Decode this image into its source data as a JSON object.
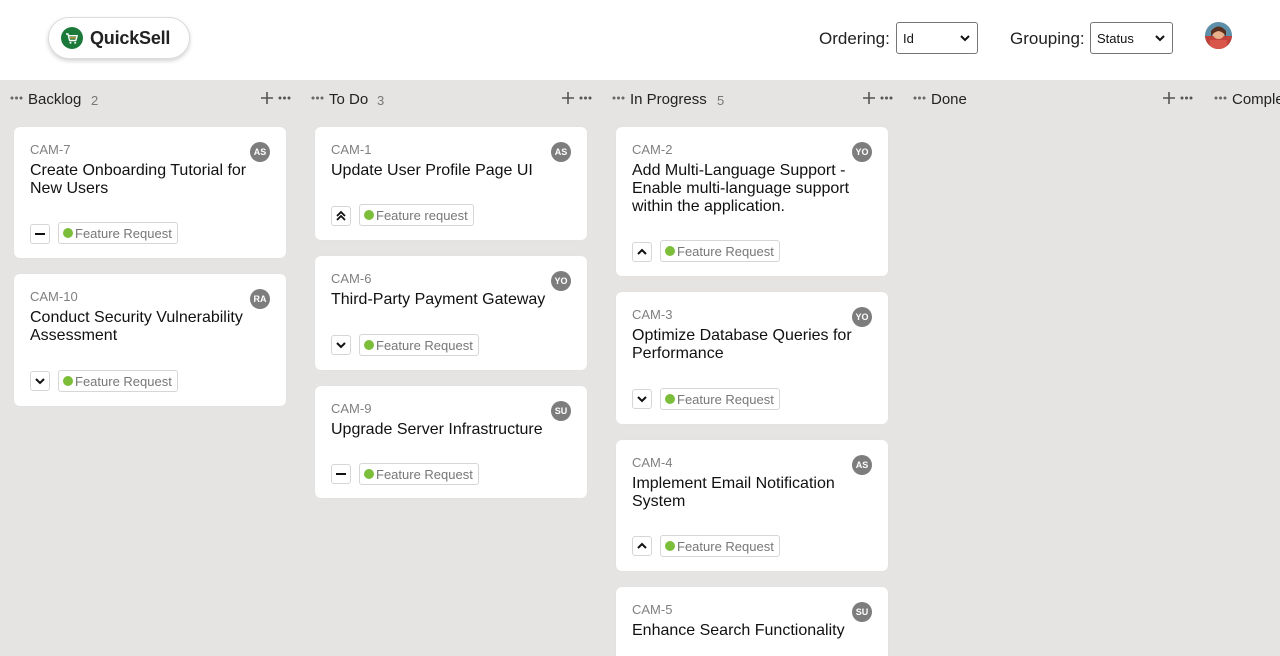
{
  "header": {
    "logo_text": "QuickSell",
    "ordering_label": "Ordering:",
    "ordering_value": "Id",
    "grouping_label": "Grouping:",
    "grouping_value": "Status"
  },
  "columns": [
    {
      "title": "Backlog",
      "count": "2"
    },
    {
      "title": "To Do",
      "count": "3"
    },
    {
      "title": "In Progress",
      "count": "5"
    },
    {
      "title": "Done",
      "count": ""
    },
    {
      "title": "Comple",
      "count": ""
    }
  ],
  "cards": {
    "backlog": [
      {
        "id": "CAM-7",
        "avatar": "AS",
        "title": "Create Onboarding Tutorial for New Users",
        "priority_icon": "no-priority-icon",
        "tag": "Feature Request"
      },
      {
        "id": "CAM-10",
        "avatar": "RA",
        "title": "Conduct Security Vulnerability Assessment",
        "priority_icon": "low-priority-icon",
        "tag": "Feature Request"
      }
    ],
    "todo": [
      {
        "id": "CAM-1",
        "avatar": "AS",
        "title": "Update User Profile Page UI",
        "priority_icon": "urgent-priority-icon",
        "tag": "Feature request"
      },
      {
        "id": "CAM-6",
        "avatar": "YO",
        "title": "Third-Party Payment Gateway",
        "priority_icon": "low-priority-icon",
        "tag": "Feature Request"
      },
      {
        "id": "CAM-9",
        "avatar": "SU",
        "title": "Upgrade Server Infrastructure",
        "priority_icon": "no-priority-icon",
        "tag": "Feature Request"
      }
    ],
    "in_progress": [
      {
        "id": "CAM-2",
        "avatar": "YO",
        "title": "Add Multi-Language Support - Enable multi-language support within the application.",
        "priority_icon": "high-priority-icon",
        "tag": "Feature Request"
      },
      {
        "id": "CAM-3",
        "avatar": "YO",
        "title": "Optimize Database Queries for Performance",
        "priority_icon": "low-priority-icon",
        "tag": "Feature Request"
      },
      {
        "id": "CAM-4",
        "avatar": "AS",
        "title": "Implement Email Notification System",
        "priority_icon": "high-priority-icon",
        "tag": "Feature Request"
      },
      {
        "id": "CAM-5",
        "avatar": "SU",
        "title": "Enhance Search Functionality",
        "priority_icon": "",
        "tag": ""
      }
    ]
  },
  "colors": {
    "board_bg": "#e5e4e2",
    "tag_dot": "#7cbe3a",
    "avatar_bg": "#7d7d7d",
    "logo_green": "#1b7a3a"
  }
}
